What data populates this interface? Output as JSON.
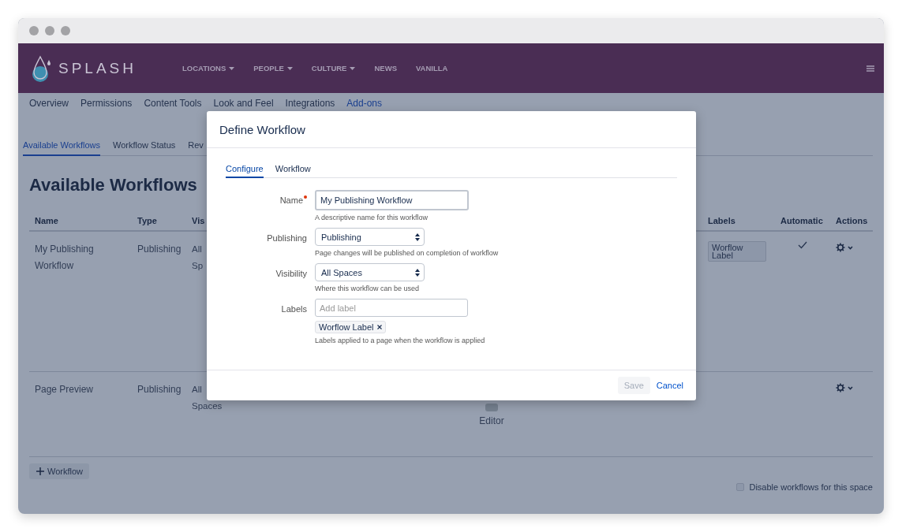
{
  "header": {
    "brand": "SPLASH",
    "nav": [
      {
        "label": "LOCATIONS",
        "dropdown": true
      },
      {
        "label": "PEOPLE",
        "dropdown": true
      },
      {
        "label": "CULTURE",
        "dropdown": true
      },
      {
        "label": "NEWS",
        "dropdown": false
      },
      {
        "label": "VANILLA",
        "dropdown": false
      }
    ]
  },
  "space_tabs": [
    {
      "label": "Overview",
      "selected": false
    },
    {
      "label": "Permissions",
      "selected": false
    },
    {
      "label": "Content Tools",
      "selected": false
    },
    {
      "label": "Look and Feel",
      "selected": false
    },
    {
      "label": "Integrations",
      "selected": false
    },
    {
      "label": "Add-ons",
      "selected": true
    }
  ],
  "sub_tabs": [
    {
      "label": "Available Workflows",
      "selected": true
    },
    {
      "label": "Workflow Status",
      "selected": false
    },
    {
      "label": "Rev",
      "selected": false
    }
  ],
  "heading": "Available Workflows",
  "table": {
    "columns": [
      "Name",
      "Type",
      "Vis",
      "Labels",
      "Automatic",
      "Actions"
    ],
    "rows": [
      {
        "name": "My Publishing Workflow",
        "type": "Publishing",
        "visibility": "All Sp",
        "labels": [
          "Worflow Label"
        ],
        "automatic": true
      },
      {
        "name": "Page Preview",
        "type": "Publishing",
        "visibility": "All Spaces",
        "editor": "Editor",
        "automatic": false
      }
    ]
  },
  "add_button": "Workflow",
  "disable_option": {
    "label": "Disable workflows for this space",
    "checked": false
  },
  "dialog": {
    "title": "Define Workflow",
    "tabs": [
      {
        "label": "Configure",
        "selected": true
      },
      {
        "label": "Workflow",
        "selected": false
      }
    ],
    "fields": [
      {
        "kind": "text",
        "label": "Name",
        "required": true,
        "value": "My Publishing Workflow",
        "help": "A descriptive name for this workflow"
      },
      {
        "kind": "select",
        "label": "Publishing",
        "required": false,
        "value": "Publishing",
        "help": "Page changes will be published on completion of workflow"
      },
      {
        "kind": "select",
        "label": "Visibility",
        "required": false,
        "value": "All Spaces",
        "help": "Where this workflow can be used"
      },
      {
        "kind": "tags",
        "label": "Labels",
        "required": false,
        "placeholder": "Add label",
        "tags": [
          "Worflow Label"
        ],
        "help": "Labels applied to a page when the workflow is applied"
      }
    ],
    "save": {
      "label": "Save",
      "disabled": true
    },
    "cancel": "Cancel"
  }
}
